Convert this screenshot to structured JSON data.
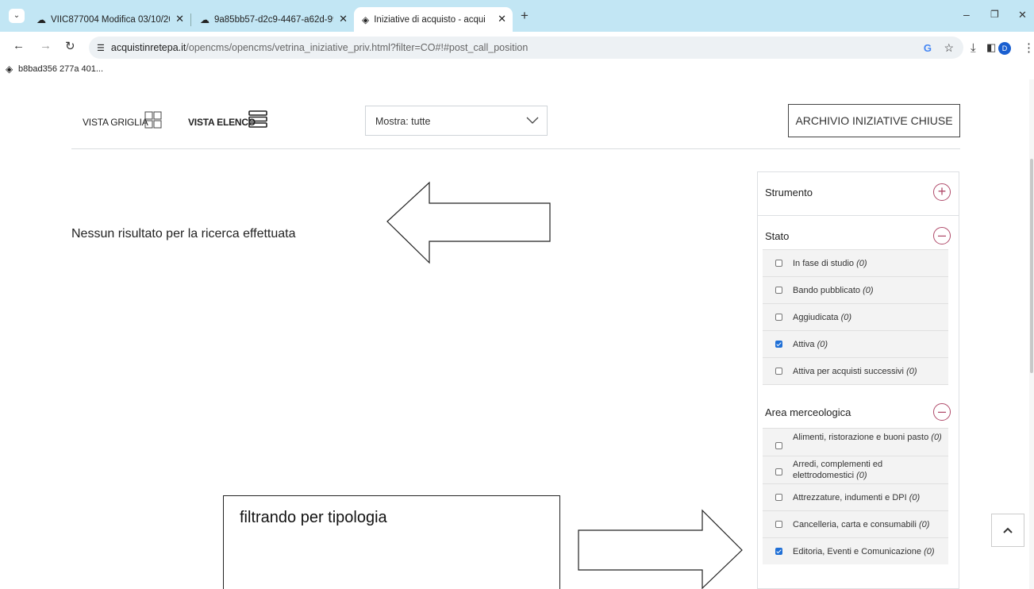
{
  "browser": {
    "tabs": [
      {
        "title": "VIIC877004 Modifica 03/10/202"
      },
      {
        "title": "9a85bb57-d2c9-4467-a62d-99"
      },
      {
        "title": "Iniziative di acquisto - acquisti"
      }
    ],
    "url_domain": "acquistinretepa.it",
    "url_path": "/opencms/opencms/vetrina_iniziative_priv.html?filter=CO#!#post_call_position",
    "bookmark": "b8bad356 277a 401...",
    "profile_initial": "D"
  },
  "toolbar": {
    "grid_view_label": "VISTA GRIGLIA",
    "list_view_label": "VISTA ELENCO",
    "filter_select_value": "Mostra: tutte",
    "archive_button": "ARCHIVIO INIZIATIVE CHIUSE"
  },
  "results": {
    "empty_message": "Nessun risultato per la ricerca effettuata"
  },
  "filters": {
    "strumento": {
      "label": "Strumento"
    },
    "stato": {
      "label": "Stato",
      "options": [
        {
          "label": "In fase di studio",
          "count": "(0)",
          "checked": false
        },
        {
          "label": "Bando pubblicato",
          "count": "(0)",
          "checked": false
        },
        {
          "label": "Aggiudicata",
          "count": "(0)",
          "checked": false
        },
        {
          "label": "Attiva",
          "count": "(0)",
          "checked": true
        },
        {
          "label": "Attiva per acquisti successivi",
          "count": "(0)",
          "checked": false
        }
      ]
    },
    "area": {
      "label": "Area merceologica",
      "options": [
        {
          "label": "Alimenti, ristorazione e buoni pasto",
          "count": "(0)",
          "checked": false
        },
        {
          "label": "Arredi, complementi ed elettrodomestici",
          "count": "(0)",
          "checked": false
        },
        {
          "label": "Attrezzature, indumenti e DPI",
          "count": "(0)",
          "checked": false
        },
        {
          "label": "Cancelleria, carta e consumabili",
          "count": "(0)",
          "checked": false
        },
        {
          "label": "Editoria, Eventi e Comunicazione",
          "count": "(0)",
          "checked": true
        }
      ]
    }
  },
  "annotation": {
    "callout_text": "filtrando per tipologia"
  },
  "colors": {
    "tabstrip": "#c2e6f4",
    "accent": "#b04a6a",
    "checkbox_checked": "#1f6fd6"
  }
}
